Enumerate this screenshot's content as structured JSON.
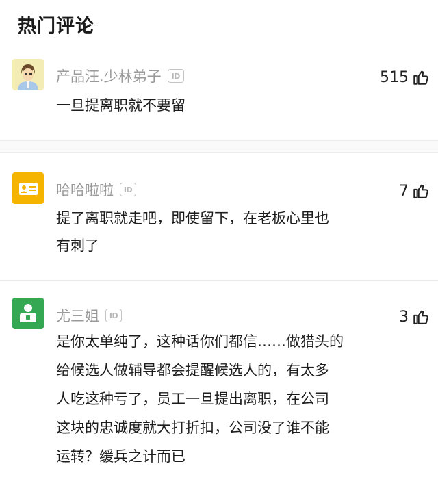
{
  "header": {
    "title": "热门评论"
  },
  "badge_text": "ID",
  "comments": [
    {
      "username": "产品汪.少林弟子",
      "likes": "515",
      "lines": [
        "一旦提离职就不要留"
      ],
      "avatar_bg": "#f3edb5"
    },
    {
      "username": "哈哈啦啦",
      "likes": "7",
      "lines": [
        "提了离职就走吧，即使留下，在老板心里也",
        "有刺了"
      ],
      "avatar_bg": "#f5b400"
    },
    {
      "username": "尤三姐",
      "likes": "3",
      "lines": [
        "是你太单纯了，这种话你们都信……做猎头的",
        "给候选人做辅导都会提醒候选人的，有太多",
        "人吃这种亏了，员工一旦提出离职，在公司",
        "这块的忠诚度就大打折扣，公司没了谁不能",
        "运转？缓兵之计而已"
      ],
      "avatar_bg": "#34a853"
    }
  ],
  "icons": {
    "like": "thumbs-up-icon",
    "id_badge": "id-badge-icon"
  }
}
